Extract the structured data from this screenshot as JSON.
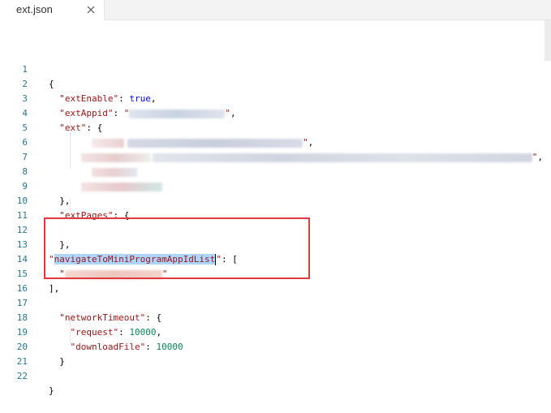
{
  "tab": {
    "label": "ext.json",
    "close_glyph": "✕"
  },
  "lines": [
    {
      "n": "1"
    },
    {
      "n": "2"
    },
    {
      "n": "3"
    },
    {
      "n": "4"
    },
    {
      "n": "5"
    },
    {
      "n": "6"
    },
    {
      "n": "7"
    },
    {
      "n": "8"
    },
    {
      "n": "9"
    },
    {
      "n": "10"
    },
    {
      "n": "11"
    },
    {
      "n": "12"
    },
    {
      "n": "13"
    },
    {
      "n": "14"
    },
    {
      "n": "15"
    },
    {
      "n": "16"
    },
    {
      "n": "17"
    },
    {
      "n": "18"
    },
    {
      "n": "19"
    },
    {
      "n": "20"
    },
    {
      "n": "21"
    },
    {
      "n": "22"
    }
  ],
  "code": {
    "open_brace": "{",
    "ext_enable_key": "\"extEnable\"",
    "ext_enable_val": "true",
    "ext_appid_key": "\"extAppid\"",
    "ext_key": "\"ext\"",
    "ext_pages_key": "\"extPages\"",
    "navigate_key": "navigateToMiniProgramAppIdList",
    "network_timeout_key": "\"networkTimeout\"",
    "request_key": "\"request\"",
    "request_val": "10000",
    "download_key": "\"downloadFile\"",
    "download_val": "10000",
    "close_brace": "}"
  },
  "colors": {
    "string": "#a31515",
    "keyword": "#0000ff",
    "number": "#098658",
    "line_number": "#237893",
    "selection": "#add6ff",
    "highlight_box": "#e0393e"
  }
}
